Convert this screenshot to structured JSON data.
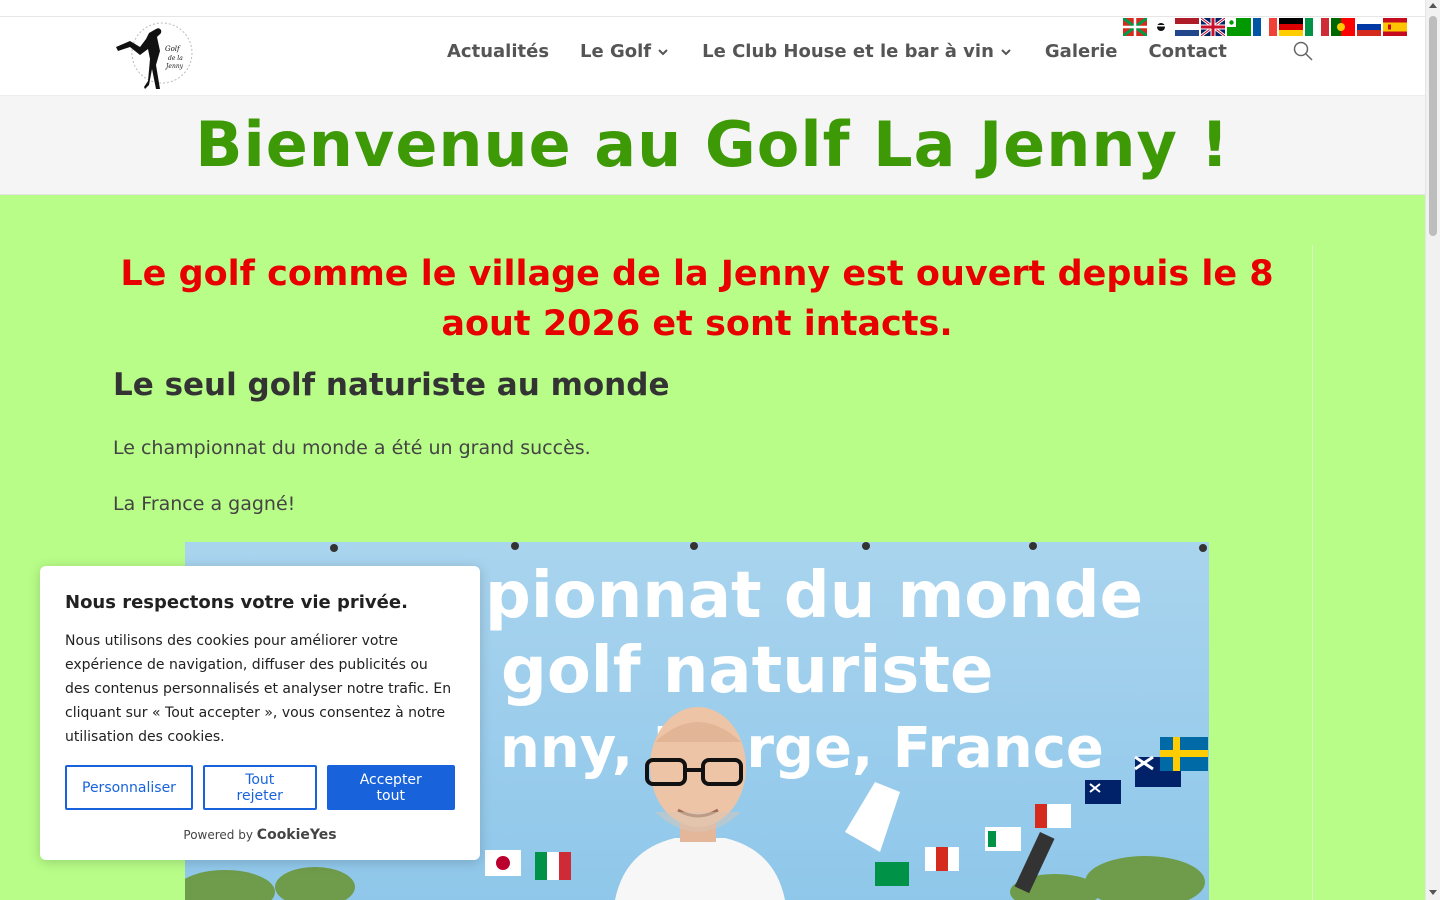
{
  "nav": {
    "items": [
      {
        "label": "Actualités",
        "has_dropdown": false
      },
      {
        "label": "Le Golf",
        "has_dropdown": true
      },
      {
        "label": "Le Club House et le bar à vin",
        "has_dropdown": true
      },
      {
        "label": "Galerie",
        "has_dropdown": false
      },
      {
        "label": "Contact",
        "has_dropdown": false
      }
    ],
    "search_icon": "search-icon"
  },
  "logo": {
    "text_line1": "Golf",
    "text_line2": "de la",
    "text_line3": "Jenny"
  },
  "flags": [
    "basque",
    "corsican",
    "dutch",
    "english",
    "esperanto",
    "french",
    "german",
    "italian",
    "portuguese",
    "russian",
    "spanish"
  ],
  "page": {
    "title": "Bienvenue au Golf La Jenny !",
    "alert": "Le golf comme le village de la Jenny est ouvert depuis le 8 aout 2026 et sont intacts.",
    "subtitle": "Le seul golf naturiste au monde",
    "paragraph1": "Le championnat du monde a été un grand succès.",
    "paragraph2": "La France a gagné!"
  },
  "photo": {
    "banner_line1": "pionnat du monde",
    "banner_line2": "golf naturiste",
    "banner_line3": "nny, Lo  rge, France"
  },
  "cookie": {
    "title": "Nous respectons votre vie privée.",
    "text": "Nous utilisons des cookies pour améliorer votre expérience de navigation, diffuser des publicités ou des contenus personnalisés et analyser notre trafic. En cliquant sur « Tout accepter », vous consentez à notre utilisation des cookies.",
    "customize": "Personnaliser",
    "reject": "Tout rejeter",
    "accept": "Accepter tout",
    "powered_by": "Powered by",
    "brand": "CookieYes"
  },
  "colors": {
    "title_green": "#3d9a06",
    "main_bg": "#b8fd88",
    "alert_red": "#e80000",
    "cookie_blue": "#1863dc"
  }
}
